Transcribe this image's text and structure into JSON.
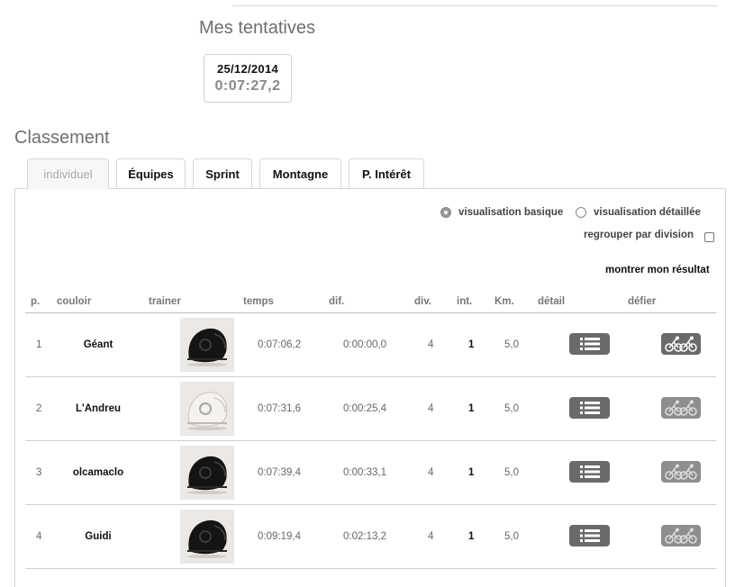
{
  "attempts": {
    "title": "Mes tentatives",
    "items": [
      {
        "date": "25/12/2014",
        "time": "0:07:27,2"
      }
    ]
  },
  "ranking": {
    "title": "Classement",
    "tabs": [
      {
        "label": "individuel",
        "active": true
      },
      {
        "label": "Équipes",
        "active": false
      },
      {
        "label": "Sprint",
        "active": false
      },
      {
        "label": "Montagne",
        "active": false
      },
      {
        "label": "P. Intérêt",
        "active": false
      }
    ],
    "view_basic_label": "visualisation basique",
    "view_detailed_label": "visualisation détaillée",
    "selected_view": "visualisation basique",
    "group_by_division_label": "regrouper par division",
    "group_by_division_checked": false,
    "show_my_result_label": "montrer mon résultat",
    "columns": [
      "p.",
      "couloir",
      "trainer",
      "temps",
      "dif.",
      "div.",
      "int.",
      "Km.",
      "détail",
      "défier"
    ],
    "rows": [
      {
        "pos": "1",
        "name": "Géant",
        "helmet": "black-helmet-icon",
        "time": "0:07:06,2",
        "diff": "0:00:00,0",
        "div": "4",
        "int": "1",
        "km": "5,0"
      },
      {
        "pos": "2",
        "name": "L'Andreu",
        "helmet": "white-helmet-icon",
        "time": "0:07:31,6",
        "diff": "0:00:25,4",
        "div": "4",
        "int": "1",
        "km": "5,0"
      },
      {
        "pos": "3",
        "name": "olcamaclo",
        "helmet": "black-helmet-icon",
        "time": "0:07:39,4",
        "diff": "0:00:33,1",
        "div": "4",
        "int": "1",
        "km": "5,0"
      },
      {
        "pos": "4",
        "name": "Guidi",
        "helmet": "black-helmet-icon",
        "time": "0:09:19,4",
        "diff": "0:02:13,2",
        "div": "4",
        "int": "1",
        "km": "5,0"
      }
    ]
  },
  "colors": {
    "button": "#6a6a6a",
    "title": "#6f6f6f",
    "rule": "#cfcfcf"
  }
}
